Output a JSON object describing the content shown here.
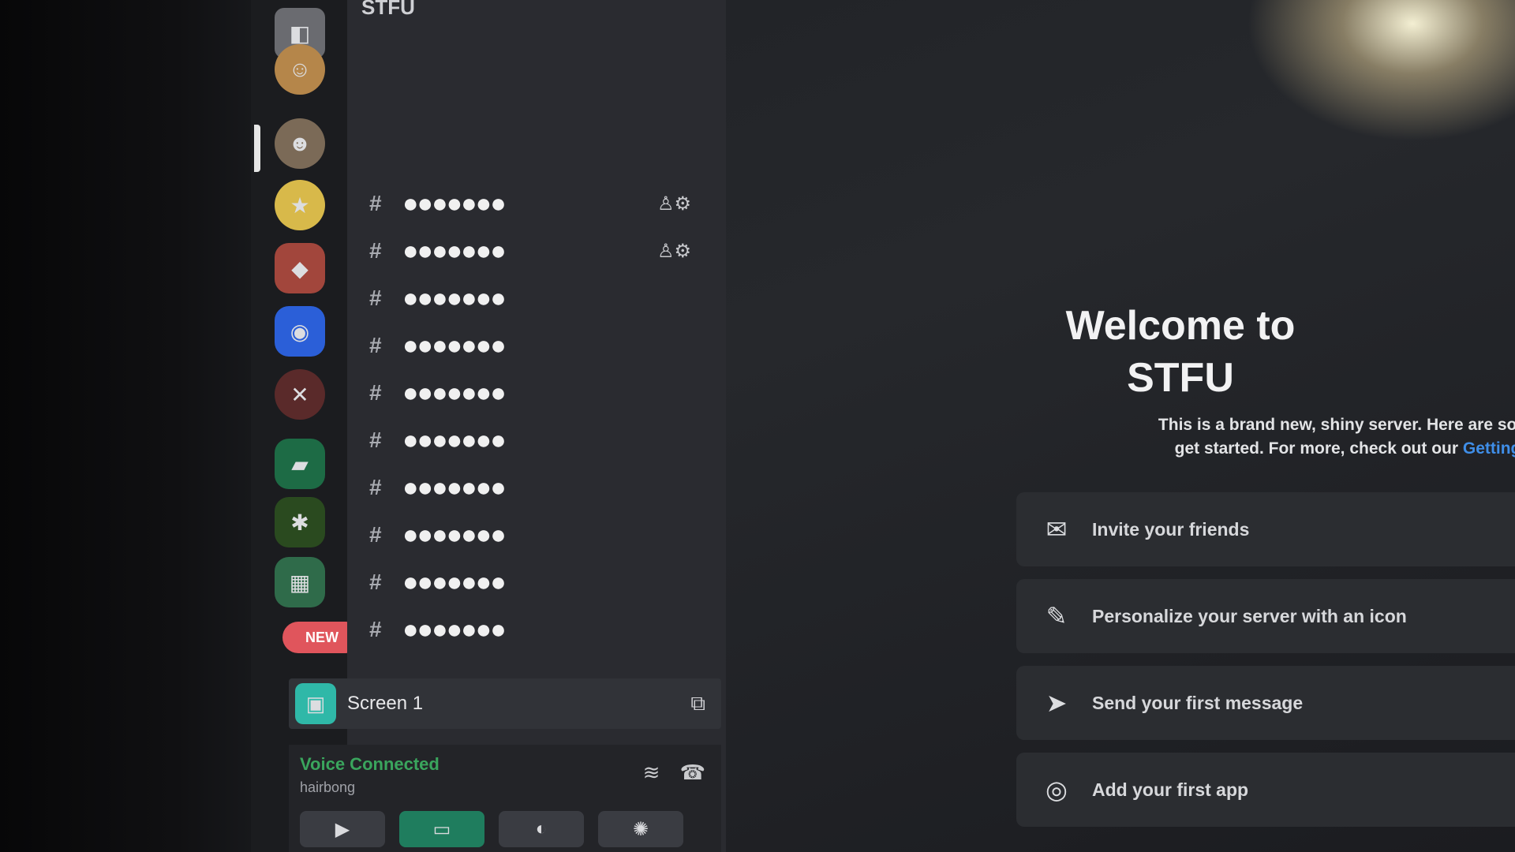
{
  "server": {
    "name": "STFU",
    "categories": [
      "",
      ""
    ]
  },
  "channels": [
    {
      "name": "●●●●●●●",
      "actions": "♙⚙"
    },
    {
      "name": "●●●●●●●",
      "actions": "♙⚙"
    },
    {
      "name": "●●●●●●●",
      "actions": ""
    },
    {
      "name": "●●●●●●●",
      "actions": ""
    },
    {
      "name": "●●●●●●●",
      "actions": ""
    },
    {
      "name": "●●●●●●●",
      "actions": ""
    },
    {
      "name": "●●●●●●●",
      "actions": ""
    },
    {
      "name": "●●●●●●●",
      "actions": ""
    },
    {
      "name": "●●●●●●●",
      "actions": ""
    },
    {
      "name": "●●●●●●●",
      "actions": ""
    }
  ],
  "rail": {
    "new_badge": "NEW"
  },
  "stream": {
    "label": "Screen 1"
  },
  "voice": {
    "status": "Voice Connected",
    "channel": "hairbong"
  },
  "welcome": {
    "title_line1": "Welcome to",
    "title_line2": "STFU",
    "desc_line1": "This is a brand new, shiny server. Here are some steps to help",
    "desc_line2_prefix": "get started. For more, check out our ",
    "desc_link": "Getting Started guide"
  },
  "tasks": [
    {
      "label": "Invite your friends",
      "icon": "invite-icon"
    },
    {
      "label": "Personalize your server with an icon",
      "icon": "personalize-icon"
    },
    {
      "label": "Send your first message",
      "icon": "message-icon"
    },
    {
      "label": "Add your first app",
      "icon": "app-icon"
    }
  ],
  "colors": {
    "accent_link": "#3f8ee8",
    "voice_connected": "#3aa55d",
    "badge_new": "#e0555c"
  }
}
